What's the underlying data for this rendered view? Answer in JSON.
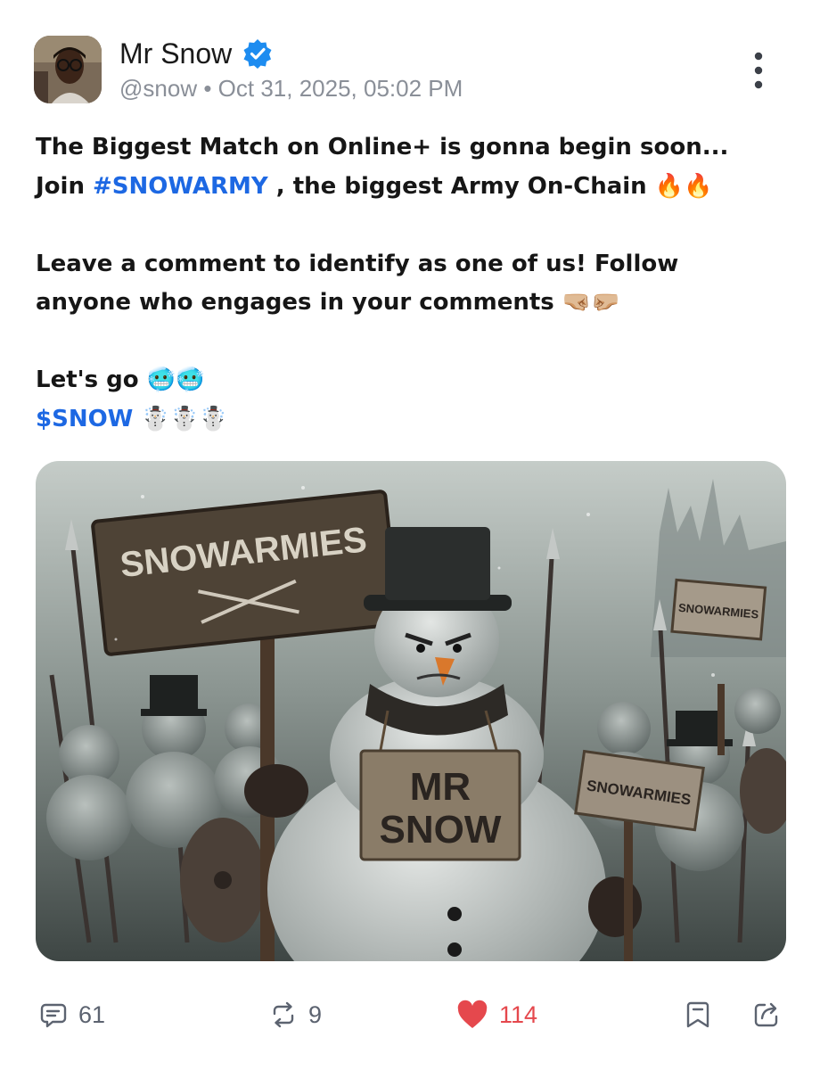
{
  "author": {
    "name": "Mr Snow",
    "handle": "@snow",
    "separator": "•",
    "timestamp": "Oct 31, 2025, 05:02 PM",
    "verified": true
  },
  "post": {
    "line1": "The Biggest Match on Online+ is gonna begin soon...",
    "line2_prefix": "Join ",
    "hashtag": "#SNOWARMY",
    "line2_suffix": " ,  the biggest Army On-Chain 🔥🔥",
    "line3": "Leave a comment to identify as one of us! Follow",
    "line4": "anyone who engages in your comments 🤜🏼🤛🏼",
    "line5": "Let's go 🥶🥶",
    "cashtag": "$SNOW",
    "cashtag_suffix": " ☃️☃️☃️"
  },
  "image": {
    "big_sign": "SNOWARMIES",
    "chest_sign_line1": "MR",
    "chest_sign_line2": "SNOW",
    "small_sign_top": "SNOWARMIES",
    "small_sign_bottom": "SNOWARMIES"
  },
  "actions": {
    "comments": "61",
    "reposts": "9",
    "likes": "114",
    "liked": true
  },
  "colors": {
    "accent": "#1d68e3",
    "like": "#e5484d",
    "muted": "#8a8f98"
  },
  "icons": [
    "verified-badge-icon",
    "more-options-icon",
    "comment-icon",
    "repost-icon",
    "heart-icon",
    "bookmark-icon",
    "share-icon"
  ]
}
